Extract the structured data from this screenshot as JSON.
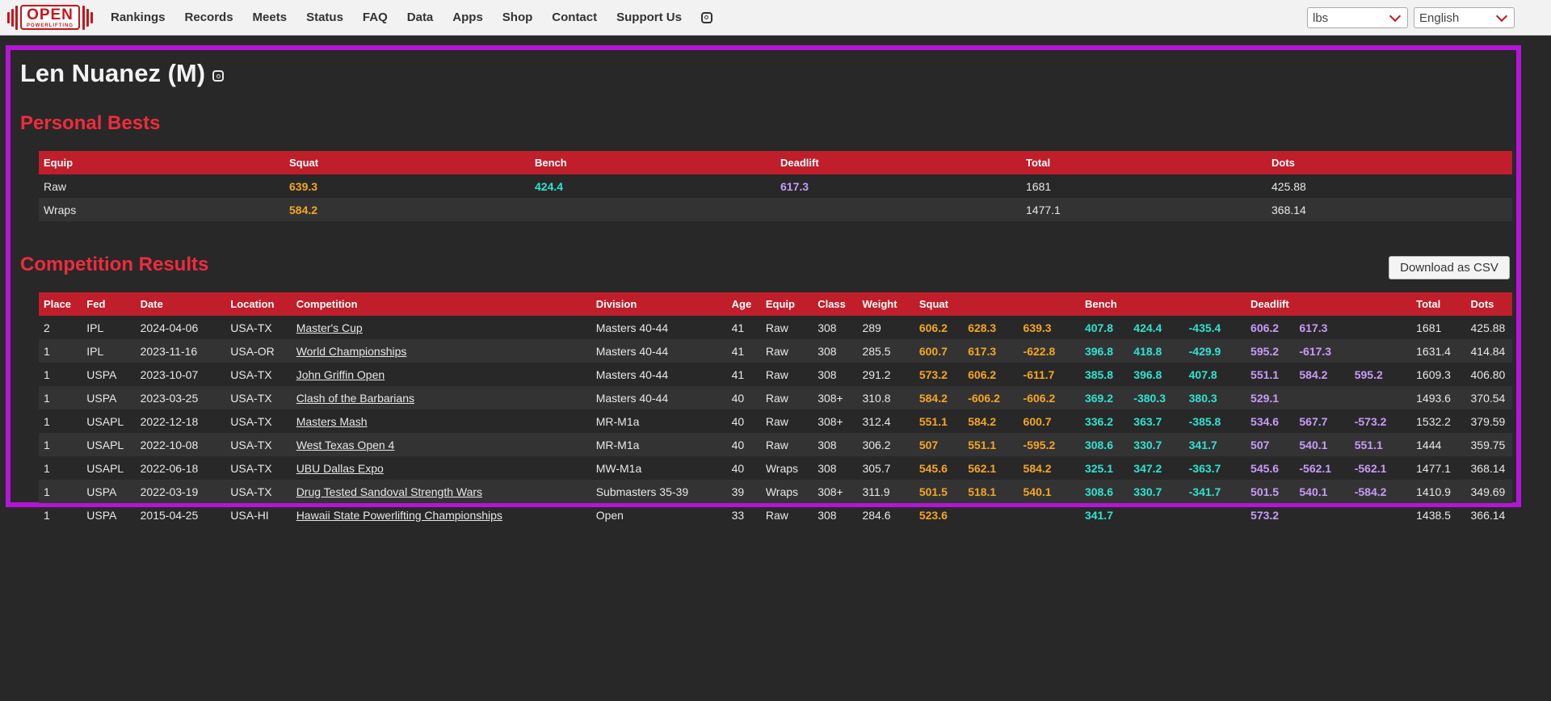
{
  "logo": {
    "big": "OPEN",
    "small": "POWERLIFTING"
  },
  "nav": [
    "Rankings",
    "Records",
    "Meets",
    "Status",
    "FAQ",
    "Data",
    "Apps",
    "Shop",
    "Contact",
    "Support Us"
  ],
  "units_select": "lbs",
  "language_select": "English",
  "lifter": {
    "name": "Len Nuanez (M)"
  },
  "personal_bests": {
    "title": "Personal Bests",
    "headers": [
      "Equip",
      "Squat",
      "Bench",
      "Deadlift",
      "Total",
      "Dots"
    ],
    "rows": [
      [
        "Raw",
        "639.3",
        "424.4",
        "617.3",
        "1681",
        "425.88"
      ],
      [
        "Wraps",
        "584.2",
        "",
        "",
        "1477.1",
        "368.14"
      ]
    ]
  },
  "competition": {
    "title": "Competition Results",
    "download_label": "Download as CSV",
    "headers": [
      "Place",
      "Fed",
      "Date",
      "Location",
      "Competition",
      "Division",
      "Age",
      "Equip",
      "Class",
      "Weight",
      "Squat",
      "",
      "",
      "Bench",
      "",
      "",
      "Deadlift",
      "",
      "",
      "Total",
      "Dots"
    ],
    "rows": [
      [
        "2",
        "IPL",
        "2024-04-06",
        "USA-TX",
        "Master's Cup",
        "Masters 40-44",
        "41",
        "Raw",
        "308",
        "289",
        "606.2",
        "628.3",
        "639.3",
        "407.8",
        "424.4",
        "-435.4",
        "606.2",
        "617.3",
        "",
        "1681",
        "425.88"
      ],
      [
        "1",
        "IPL",
        "2023-11-16",
        "USA-OR",
        "World Championships",
        "Masters 40-44",
        "41",
        "Raw",
        "308",
        "285.5",
        "600.7",
        "617.3",
        "-622.8",
        "396.8",
        "418.8",
        "-429.9",
        "595.2",
        "-617.3",
        "",
        "1631.4",
        "414.84"
      ],
      [
        "1",
        "USPA",
        "2023-10-07",
        "USA-TX",
        "John Griffin Open",
        "Masters 40-44",
        "41",
        "Raw",
        "308",
        "291.2",
        "573.2",
        "606.2",
        "-611.7",
        "385.8",
        "396.8",
        "407.8",
        "551.1",
        "584.2",
        "595.2",
        "1609.3",
        "406.80"
      ],
      [
        "1",
        "USPA",
        "2023-03-25",
        "USA-TX",
        "Clash of the Barbarians",
        "Masters 40-44",
        "40",
        "Raw",
        "308+",
        "310.8",
        "584.2",
        "-606.2",
        "-606.2",
        "369.2",
        "-380.3",
        "380.3",
        "529.1",
        "",
        "",
        "1493.6",
        "370.54"
      ],
      [
        "1",
        "USAPL",
        "2022-12-18",
        "USA-TX",
        "Masters Mash",
        "MR-M1a",
        "40",
        "Raw",
        "308+",
        "312.4",
        "551.1",
        "584.2",
        "600.7",
        "336.2",
        "363.7",
        "-385.8",
        "534.6",
        "567.7",
        "-573.2",
        "1532.2",
        "379.59"
      ],
      [
        "1",
        "USAPL",
        "2022-10-08",
        "USA-TX",
        "West Texas Open 4",
        "MR-M1a",
        "40",
        "Raw",
        "308",
        "306.2",
        "507",
        "551.1",
        "-595.2",
        "308.6",
        "330.7",
        "341.7",
        "507",
        "540.1",
        "551.1",
        "1444",
        "359.75"
      ],
      [
        "1",
        "USAPL",
        "2022-06-18",
        "USA-TX",
        "UBU Dallas Expo",
        "MW-M1a",
        "40",
        "Wraps",
        "308",
        "305.7",
        "545.6",
        "562.1",
        "584.2",
        "325.1",
        "347.2",
        "-363.7",
        "545.6",
        "-562.1",
        "-562.1",
        "1477.1",
        "368.14"
      ],
      [
        "1",
        "USPA",
        "2022-03-19",
        "USA-TX",
        "Drug Tested Sandoval Strength Wars",
        "Submasters 35-39",
        "39",
        "Wraps",
        "308+",
        "311.9",
        "501.5",
        "518.1",
        "540.1",
        "308.6",
        "330.7",
        "-341.7",
        "501.5",
        "540.1",
        "-584.2",
        "1410.9",
        "349.69"
      ],
      [
        "1",
        "USPA",
        "2015-04-25",
        "USA-HI",
        "Hawaii State Powerlifting Championships",
        "Open",
        "33",
        "Raw",
        "308",
        "284.6",
        "523.6",
        "",
        "",
        "341.7",
        "",
        "",
        "573.2",
        "",
        "",
        "1438.5",
        "366.14"
      ]
    ]
  }
}
